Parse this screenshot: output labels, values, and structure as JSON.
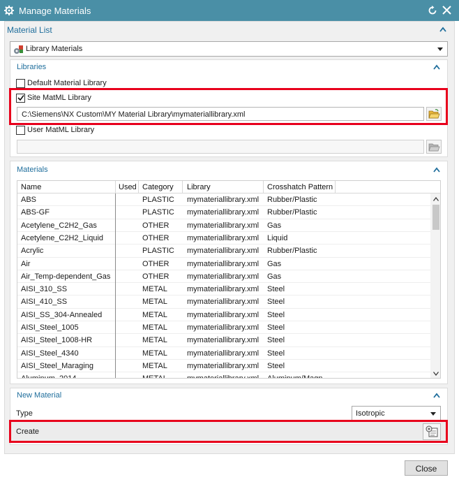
{
  "window": {
    "title": "Manage Materials"
  },
  "material_list": {
    "label": "Material List",
    "selected": "Library Materials"
  },
  "libraries": {
    "label": "Libraries",
    "default_lib": {
      "label": "Default Material Library",
      "checked": false
    },
    "site_lib": {
      "label": "Site MatML Library",
      "checked": true,
      "path": "C:\\Siemens\\NX Custom\\MY Material Library\\mymateriallibrary.xml"
    },
    "user_lib": {
      "label": "User MatML Library",
      "checked": false,
      "path": ""
    }
  },
  "materials": {
    "label": "Materials",
    "columns": [
      "Name",
      "Used",
      "Category",
      "Library",
      "Crosshatch Pattern"
    ],
    "rows": [
      [
        "ABS",
        "",
        "PLASTIC",
        "mymateriallibrary.xml",
        "Rubber/Plastic"
      ],
      [
        "ABS-GF",
        "",
        "PLASTIC",
        "mymateriallibrary.xml",
        "Rubber/Plastic"
      ],
      [
        "Acetylene_C2H2_Gas",
        "",
        "OTHER",
        "mymateriallibrary.xml",
        "Gas"
      ],
      [
        "Acetylene_C2H2_Liquid",
        "",
        "OTHER",
        "mymateriallibrary.xml",
        "Liquid"
      ],
      [
        "Acrylic",
        "",
        "PLASTIC",
        "mymateriallibrary.xml",
        "Rubber/Plastic"
      ],
      [
        "Air",
        "",
        "OTHER",
        "mymateriallibrary.xml",
        "Gas"
      ],
      [
        "Air_Temp-dependent_Gas",
        "",
        "OTHER",
        "mymateriallibrary.xml",
        "Gas"
      ],
      [
        "AISI_310_SS",
        "",
        "METAL",
        "mymateriallibrary.xml",
        "Steel"
      ],
      [
        "AISI_410_SS",
        "",
        "METAL",
        "mymateriallibrary.xml",
        "Steel"
      ],
      [
        "AISI_SS_304-Annealed",
        "",
        "METAL",
        "mymateriallibrary.xml",
        "Steel"
      ],
      [
        "AISI_Steel_1005",
        "",
        "METAL",
        "mymateriallibrary.xml",
        "Steel"
      ],
      [
        "AISI_Steel_1008-HR",
        "",
        "METAL",
        "mymateriallibrary.xml",
        "Steel"
      ],
      [
        "AISI_Steel_4340",
        "",
        "METAL",
        "mymateriallibrary.xml",
        "Steel"
      ],
      [
        "AISI_Steel_Maraging",
        "",
        "METAL",
        "mymateriallibrary.xml",
        "Steel"
      ],
      [
        "Aluminum_2014",
        "",
        "METAL",
        "mymateriallibrary.xml",
        "Aluminum/Magn"
      ]
    ]
  },
  "new_material": {
    "label": "New Material",
    "type_label": "Type",
    "type_value": "Isotropic",
    "create_label": "Create"
  },
  "footer": {
    "close_label": "Close"
  },
  "colors": {
    "titlebar": "#4a8fa6",
    "section_text": "#1f6e9c",
    "highlight": "#e8001c"
  }
}
